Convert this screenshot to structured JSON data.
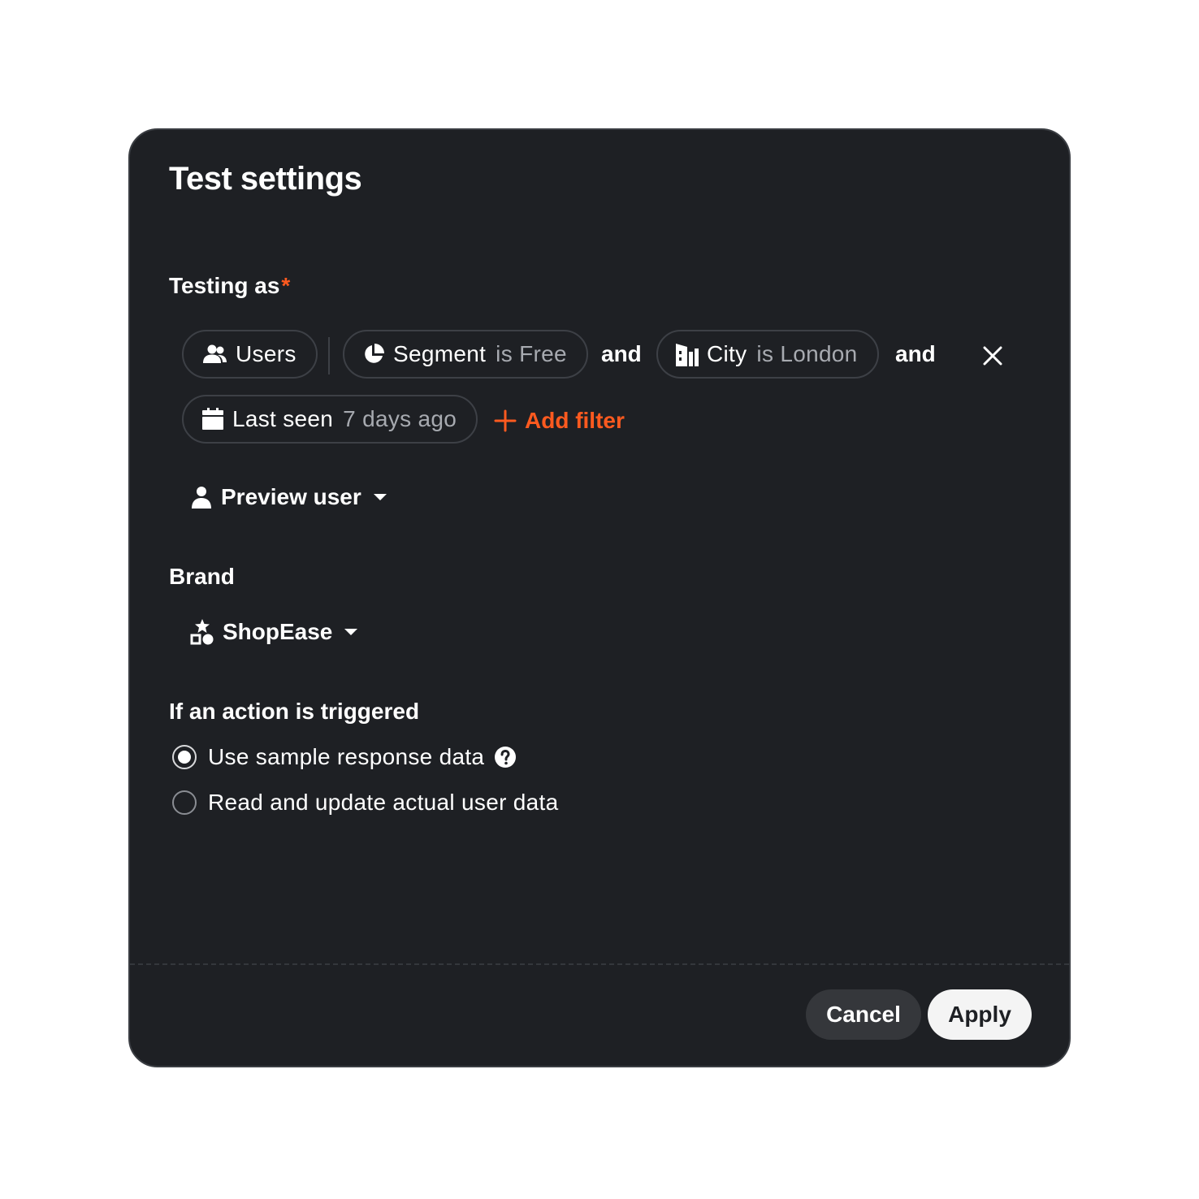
{
  "dialog": {
    "title": "Test settings"
  },
  "testing_as": {
    "label": "Testing as",
    "required_mark": "*",
    "chips": {
      "users": {
        "label": "Users"
      },
      "segment": {
        "field": "Segment",
        "condition": "is Free"
      },
      "city": {
        "field": "City",
        "condition": "is London"
      },
      "last_seen": {
        "field": "Last seen",
        "condition": "7 days ago"
      }
    },
    "joiner_1": "and",
    "joiner_2": "and",
    "add_filter": "Add filter",
    "preview_user": "Preview user"
  },
  "brand": {
    "label": "Brand",
    "selected": "ShopEase"
  },
  "action": {
    "label": "If an action is triggered",
    "options": [
      {
        "label": "Use sample response data",
        "selected": true
      },
      {
        "label": "Read and update actual user data",
        "selected": false
      }
    ]
  },
  "footer": {
    "cancel": "Cancel",
    "apply": "Apply"
  },
  "colors": {
    "accent": "#ff5a1f",
    "background": "#1e2024"
  }
}
